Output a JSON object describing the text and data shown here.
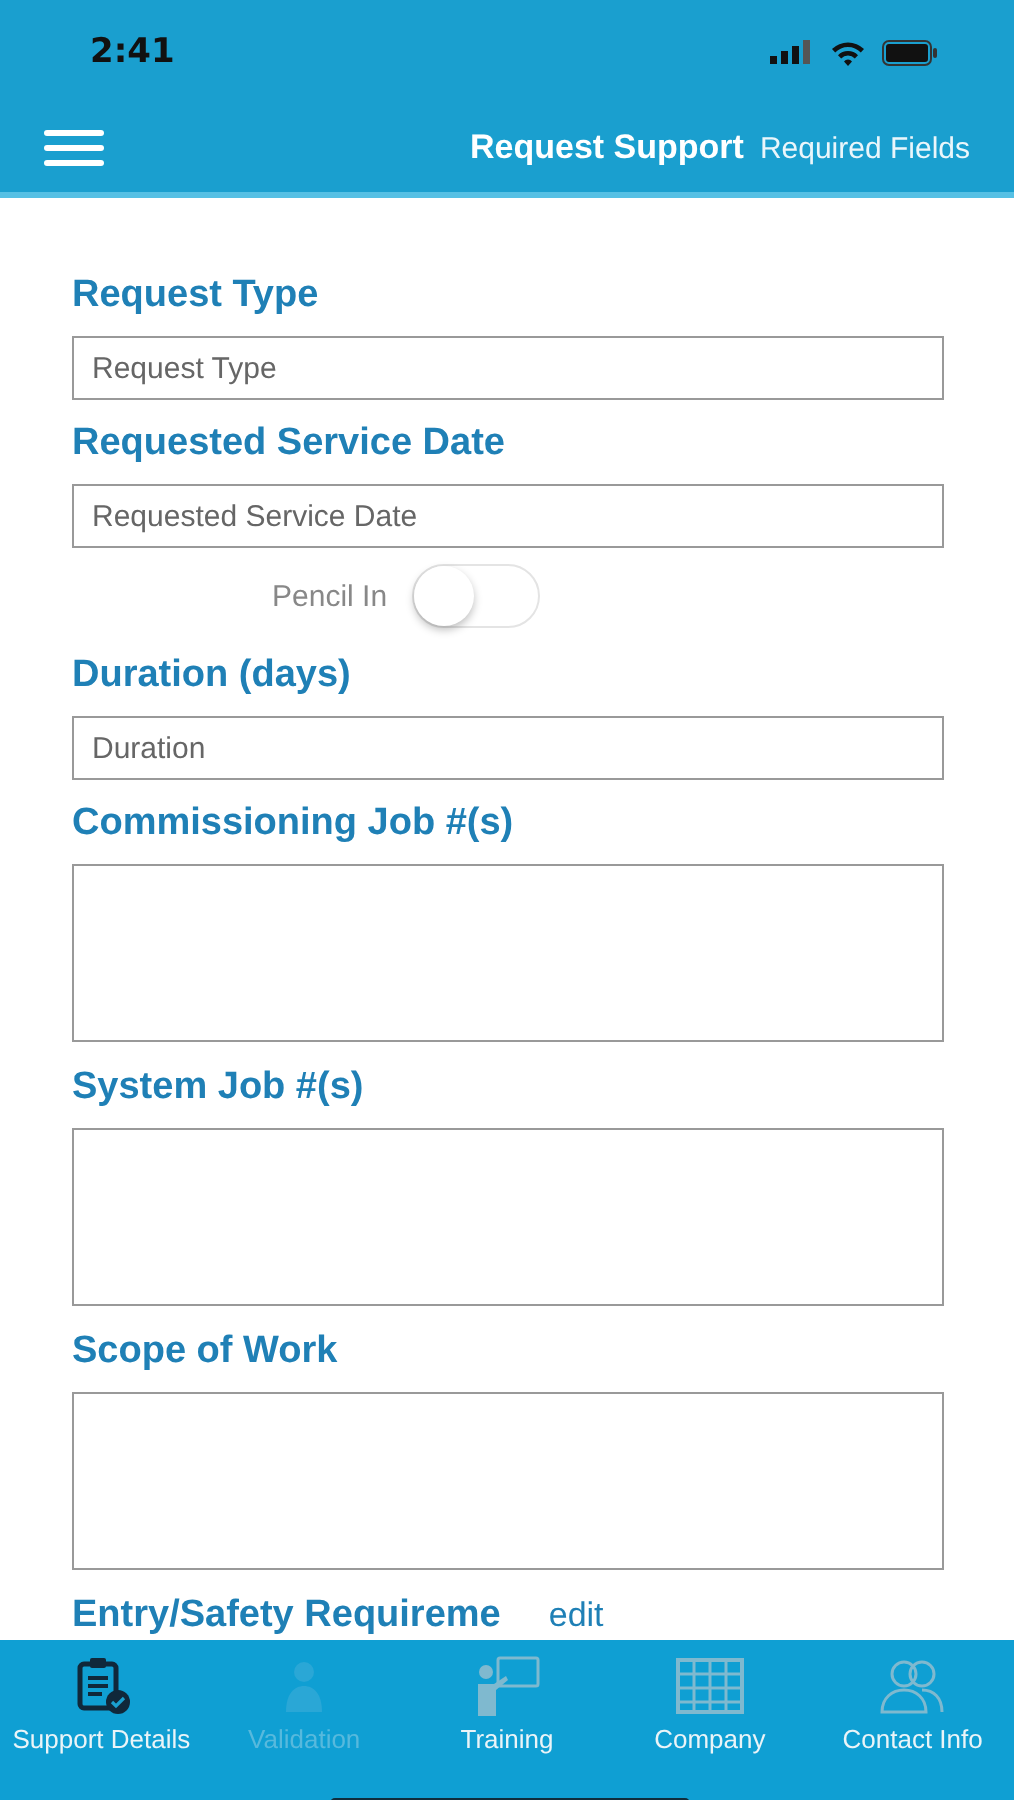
{
  "status_bar": {
    "time": "2:41"
  },
  "nav_bar": {
    "title": "Request Support",
    "action": "Required Fields"
  },
  "form": [
    {
      "kind": "input",
      "label": "Request Type",
      "placeholder": "Request Type"
    },
    {
      "kind": "input",
      "label": "Requested Service Date",
      "placeholder": "Requested Service Date"
    },
    {
      "kind": "toggle",
      "label": "Pencil In",
      "on": false
    },
    {
      "kind": "input",
      "label": "Duration (days)",
      "placeholder": "Duration"
    },
    {
      "kind": "textarea",
      "label": "Commissioning Job #(s)"
    },
    {
      "kind": "textarea",
      "label": "System Job #(s)"
    },
    {
      "kind": "textarea",
      "label": "Scope of Work"
    },
    {
      "kind": "edit",
      "label": "Entry/Safety Requireme",
      "link": "edit"
    }
  ],
  "tabs": [
    {
      "label": "Support Details",
      "selected": true,
      "disabled": false
    },
    {
      "label": "Validation",
      "selected": false,
      "disabled": true
    },
    {
      "label": "Training",
      "selected": false,
      "disabled": false
    },
    {
      "label": "Company",
      "selected": false,
      "disabled": false
    },
    {
      "label": "Contact Info",
      "selected": false,
      "disabled": false
    }
  ]
}
